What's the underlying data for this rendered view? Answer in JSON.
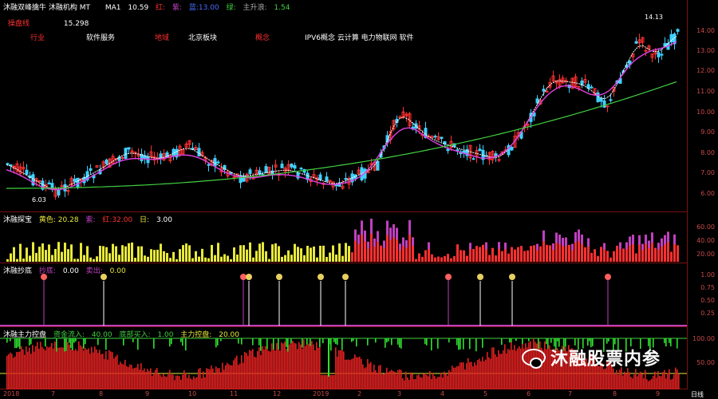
{
  "header": {
    "main_title": "沐融双峰擒牛 沐融机构 MT",
    "ma_label": "MA1",
    "ma_value": "10.59",
    "legend_items": [
      "红:",
      "紫:",
      "蓝:13.00",
      "绿:",
      "主升浪:",
      "1.54"
    ],
    "special_label": "操盘线",
    "special_value": "15.298",
    "top_right_value": "14.13"
  },
  "tags": [
    "行业",
    "软件服务",
    "地域",
    "北京板块",
    "概念",
    "IPV6概念 云计算 电力物联网 软件"
  ],
  "panels": {
    "volume": {
      "title": "沐融探宝",
      "items": [
        "黄色: 20.28",
        "紫:",
        "红:32.00",
        "日:",
        "3.00"
      ],
      "ticks": [
        "60.00",
        "40.00",
        "20.00"
      ]
    },
    "signal": {
      "title": "沐融抄底",
      "items": [
        "抄底:",
        "0.00",
        "卖出:",
        "0.00"
      ],
      "ticks": [
        "1.00",
        "0.75",
        "0.50",
        "0.25"
      ]
    },
    "main": {
      "title": "沐融主力控盘",
      "items": [
        "资金流入:",
        "40.00",
        "底部买入:",
        "1.00",
        "主力控盘:",
        "20.00"
      ],
      "ticks": [
        "100.00",
        "50.00"
      ]
    }
  },
  "price_ticks": [
    "14.00",
    "13.00",
    "12.00",
    "11.00",
    "10.00",
    "9.00",
    "8.00",
    "7.00",
    "6.00"
  ],
  "low_label": "6.03",
  "high_label": "14.13",
  "x_axis": [
    "2018",
    "7",
    "8",
    "9",
    "10",
    "11",
    "12",
    "2019",
    "2",
    "3",
    "4",
    "5",
    "6",
    "7",
    "8",
    "9",
    "日线"
  ],
  "watermark": "沐融股票内参",
  "colors": {
    "up": "#ff3030",
    "down": "#3fd0ff",
    "ma_fast": "#ffffff",
    "ma_mid": "#e040e0",
    "ma_slow": "#40d040",
    "volume_yellow": "#e8e83a",
    "volume_red": "#ff3030",
    "volume_purple": "#c040c0"
  }
}
